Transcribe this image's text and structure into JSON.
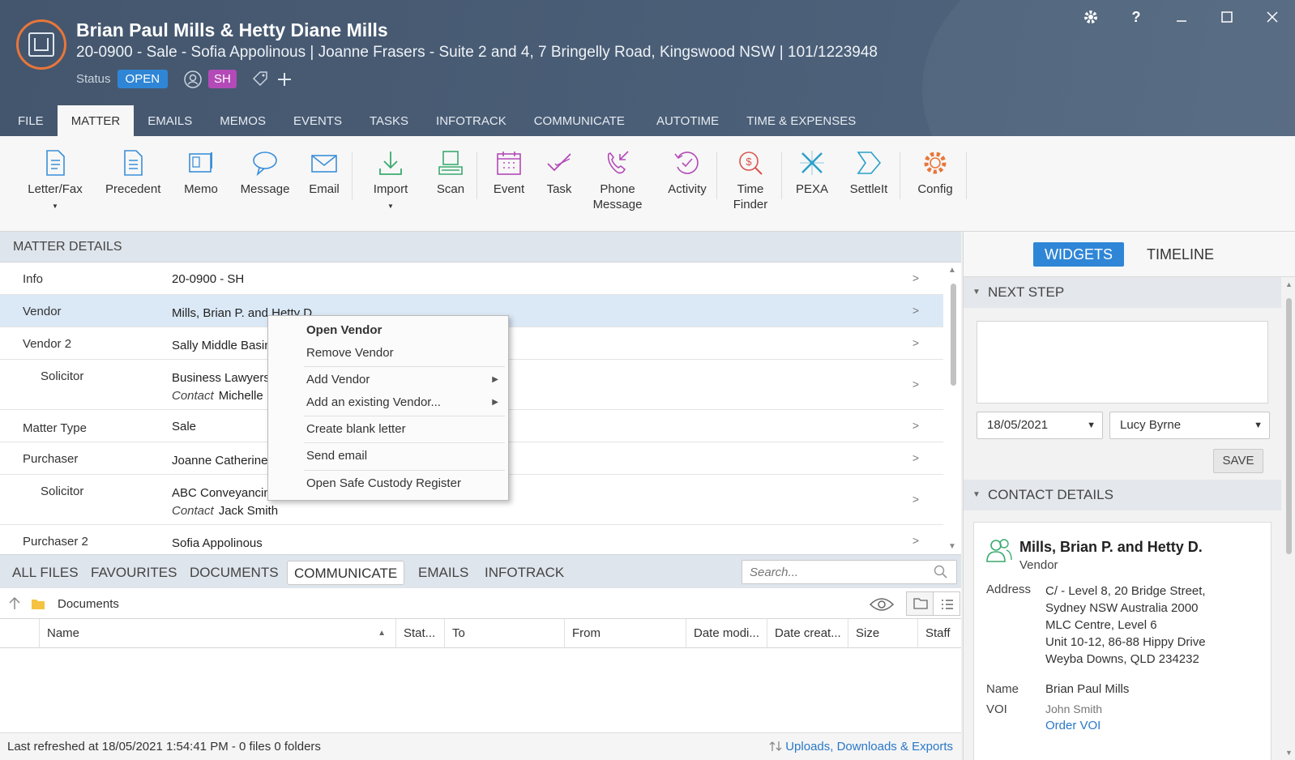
{
  "header": {
    "title": "Brian Paul Mills & Hetty Diane Mills",
    "subtitle": "20-0900 - Sale - Sofia Appolinous | Joanne Frasers - Suite 2 and 4, 7 Bringelly Road, Kingswood NSW | 101/1223948",
    "status_label": "Status",
    "status_value": "OPEN",
    "staff_initials": "SH",
    "help_glyph": "?"
  },
  "tabs": [
    "FILE",
    "MATTER",
    "EMAILS",
    "MEMOS",
    "EVENTS",
    "TASKS",
    "INFOTRACK",
    "COMMUNICATE",
    "AUTOTIME",
    "TIME & EXPENSES"
  ],
  "ribbon": {
    "letter_fax": "Letter/Fax",
    "precedent": "Precedent",
    "memo": "Memo",
    "message": "Message",
    "email": "Email",
    "import": "Import",
    "scan": "Scan",
    "event": "Event",
    "task": "Task",
    "phone_message_1": "Phone",
    "phone_message_2": "Message",
    "activity": "Activity",
    "time_finder_1": "Time",
    "time_finder_2": "Finder",
    "pexa": "PEXA",
    "settleit": "SettleIt",
    "config": "Config"
  },
  "matter_details": {
    "heading": "MATTER DETAILS",
    "rows": [
      {
        "key": "Info",
        "value": "20-0900 - SH"
      },
      {
        "key": "Vendor",
        "value": "Mills, Brian P. and Hetty D."
      },
      {
        "key": "Vendor 2",
        "value": "Sally Middle Basingthwaite"
      },
      {
        "key": "Solicitor",
        "value": "Business Lawyers",
        "contact_label": "Contact",
        "contact": "Michelle Louise Henderson"
      },
      {
        "key": "Matter Type",
        "value": "Sale"
      },
      {
        "key": "Purchaser",
        "value": "Joanne Catherine Frasers"
      },
      {
        "key": "Solicitor",
        "value": "ABC Conveyancing",
        "contact_label": "Contact",
        "contact": "Jack Smith"
      },
      {
        "key": "Purchaser 2",
        "value": "Sofia Appolinous"
      }
    ]
  },
  "context_menu": {
    "open_vendor": "Open Vendor",
    "remove_vendor": "Remove Vendor",
    "add_vendor": "Add Vendor",
    "add_existing_vendor": "Add an existing Vendor...",
    "create_blank_letter": "Create blank letter",
    "send_email": "Send email",
    "open_safe_custody": "Open Safe Custody Register"
  },
  "files": {
    "tabs": [
      "ALL FILES",
      "FAVOURITES",
      "DOCUMENTS",
      "COMMUNICATE",
      "EMAILS",
      "INFOTRACK"
    ],
    "active_tab": "COMMUNICATE",
    "search_placeholder": "Search...",
    "path": "Documents",
    "columns": [
      "Name",
      "Stat...",
      "To",
      "From",
      "Date modi...",
      "Date creat...",
      "Size",
      "Staff"
    ],
    "status_text": "Last refreshed at 18/05/2021 1:54:41 PM  -  0 files  0 folders",
    "uploads_link": "Uploads, Downloads & Exports"
  },
  "right_panel": {
    "widgets": "WIDGETS",
    "timeline": "TIMELINE",
    "next_step": "NEXT STEP",
    "date": "18/05/2021",
    "assignee": "Lucy Byrne",
    "save": "SAVE",
    "contact_details": "CONTACT DETAILS",
    "contact": {
      "name": "Mills, Brian P. and Hetty D.",
      "role": "Vendor",
      "address_label": "Address",
      "address_lines": [
        "C/ - Level 8, 20 Bridge Street,",
        "Sydney NSW Australia 2000",
        "MLC Centre, Level 6",
        "Unit 10-12, 86-88 Hippy Drive",
        "Weyba Downs, QLD 234232"
      ],
      "name_label": "Name",
      "full_name": "Brian Paul Mills",
      "voi_label": "VOI",
      "voi_value": "John Smith",
      "voi_link": "Order VOI"
    }
  },
  "colors": {
    "header_bg": "#4b5f78",
    "accent_blue": "#2f86d6",
    "logo_orange": "#e8763a",
    "staff_badge": "#b34ab8"
  }
}
